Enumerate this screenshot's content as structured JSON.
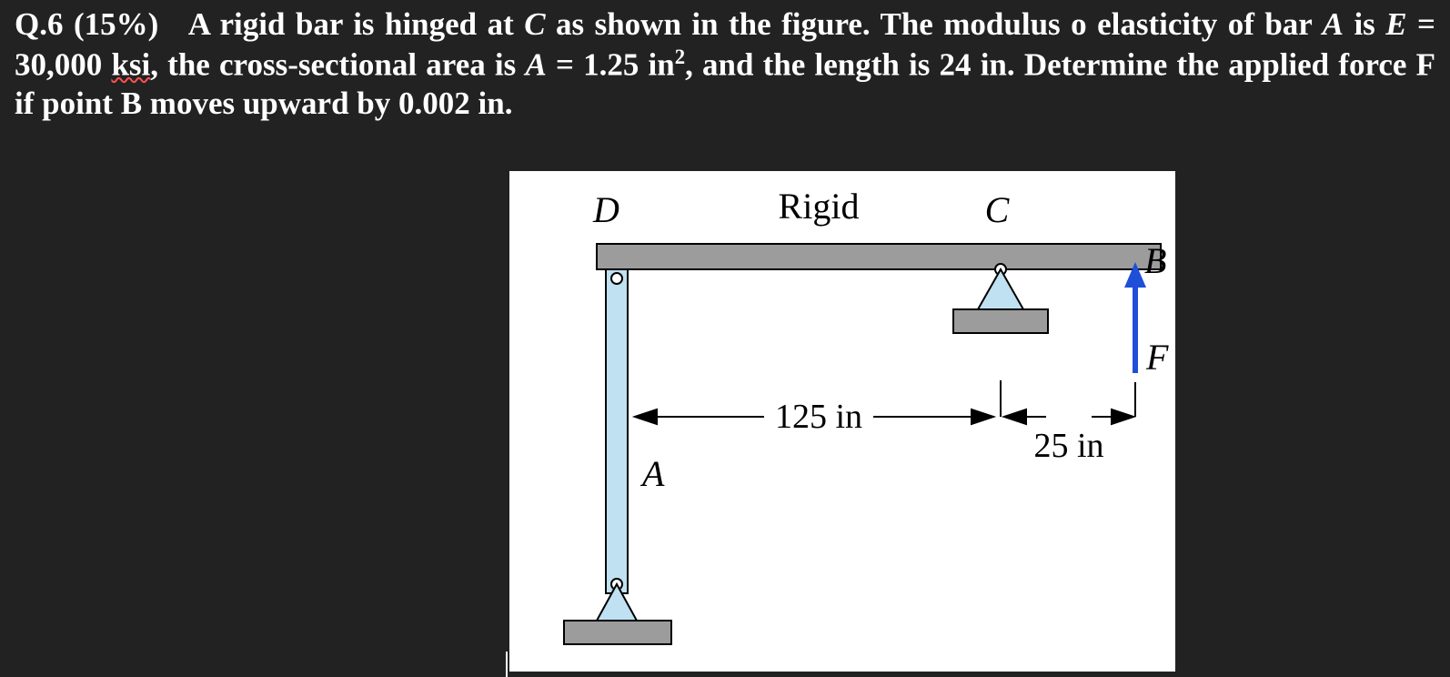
{
  "question": {
    "label": "Q.6",
    "weight": "(15%)",
    "line1a": "A rigid bar is hinged at ",
    "line1b": " as shown in the figure. The modulus o elasticity of",
    "line2a": "bar ",
    "line2b": " is ",
    "line2c": " = 30,000 ",
    "ksi": "ksi",
    "line2d": ", the cross-sectional area is ",
    "line2e": " = 1.25 in",
    "sup2": "2",
    "line2f": ", and the length is 24 in.",
    "line3": "Determine the applied force F if point B moves upward by 0.002 in.",
    "C": "C",
    "A": "A",
    "E": "E"
  },
  "figure": {
    "labels": {
      "D": "D",
      "Rigid": "Rigid",
      "C": "C",
      "B": "B",
      "F": "F",
      "A": "A",
      "dim125": "125 in",
      "dim25": "25 in"
    }
  }
}
